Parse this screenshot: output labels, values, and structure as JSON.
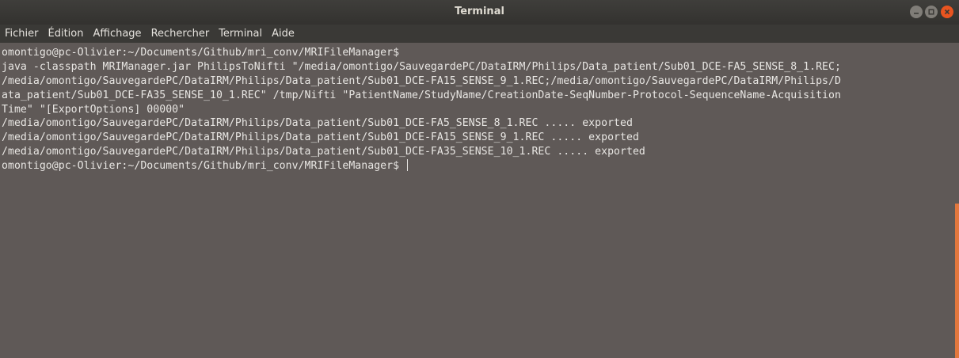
{
  "window": {
    "title": "Terminal"
  },
  "menu": [
    "Fichier",
    "Édition",
    "Affichage",
    "Rechercher",
    "Terminal",
    "Aide"
  ],
  "terminal": {
    "lines": [
      "omontigo@pc-Olivier:~/Documents/Github/mri_conv/MRIFileManager$",
      "java -classpath MRIManager.jar PhilipsToNifti \"/media/omontigo/SauvegardePC/DataIRM/Philips/Data_patient/Sub01_DCE-FA5_SENSE_8_1.REC;",
      "/media/omontigo/SauvegardePC/DataIRM/Philips/Data_patient/Sub01_DCE-FA15_SENSE_9_1.REC;/media/omontigo/SauvegardePC/DataIRM/Philips/D",
      "ata_patient/Sub01_DCE-FA35_SENSE_10_1.REC\" /tmp/Nifti \"PatientName/StudyName/CreationDate-SeqNumber-Protocol-SequenceName-Acquisition",
      "Time\" \"[ExportOptions] 00000\"",
      "/media/omontigo/SauvegardePC/DataIRM/Philips/Data_patient/Sub01_DCE-FA5_SENSE_8_1.REC ..... exported",
      "/media/omontigo/SauvegardePC/DataIRM/Philips/Data_patient/Sub01_DCE-FA15_SENSE_9_1.REC ..... exported",
      "/media/omontigo/SauvegardePC/DataIRM/Philips/Data_patient/Sub01_DCE-FA35_SENSE_10_1.REC ..... exported"
    ],
    "prompt": "omontigo@pc-Olivier:~/Documents/Github/mri_conv/MRIFileManager$"
  },
  "icons": {
    "minimize": "minimize-icon",
    "maximize": "maximize-icon",
    "close": "close-icon"
  },
  "colors": {
    "accent": "#e95420",
    "terminal_bg": "#5f5957",
    "scroll_thumb": "#e2773d"
  }
}
